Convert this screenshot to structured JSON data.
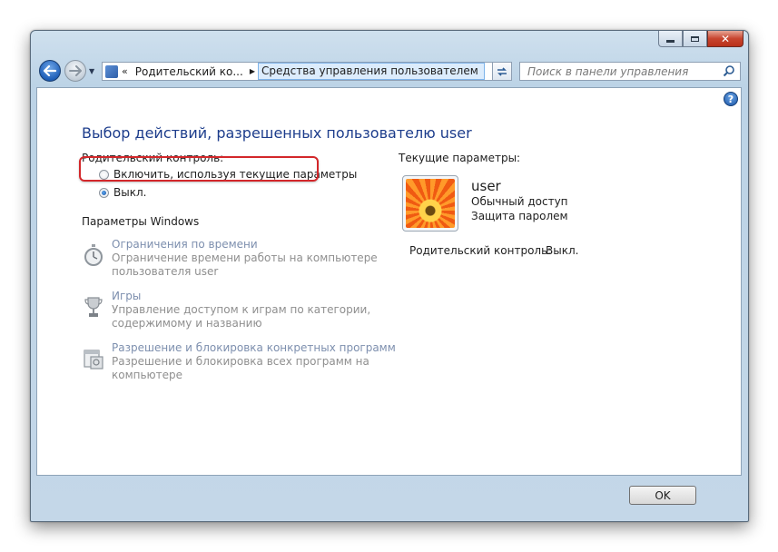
{
  "address_bar": {
    "segment_1": "Родительский ко...",
    "segment_2": "Средства управления пользователем"
  },
  "search": {
    "placeholder": "Поиск в панели управления"
  },
  "main": {
    "title": "Выбор действий, разрешенных пользователю user",
    "parental_label": "Родительский контроль:",
    "radio_on_label": "Включить, используя текущие параметры",
    "radio_off_label": "Выкл.",
    "selected": "off",
    "windows_settings_label": "Параметры Windows",
    "settings": [
      {
        "title": "Ограничения по времени",
        "desc1": "Ограничение времени работы на компьютере",
        "desc2": "пользователя user",
        "icon": "stopwatch-icon"
      },
      {
        "title": "Игры",
        "desc1": "Управление доступом к играм по категории,",
        "desc2": "содержимому и названию",
        "icon": "trophy-icon"
      },
      {
        "title": "Разрешение и блокировка конкретных программ",
        "desc1": "Разрешение и блокировка всех программ на",
        "desc2": "компьютере",
        "icon": "programs-icon"
      }
    ]
  },
  "current": {
    "heading": "Текущие параметры:",
    "user_name": "user",
    "account_type": "Обычный доступ",
    "password": "Защита паролем",
    "parental_label": "Родительский контроль:",
    "parental_value": "Выкл."
  },
  "footer": {
    "ok_label": "OK"
  }
}
